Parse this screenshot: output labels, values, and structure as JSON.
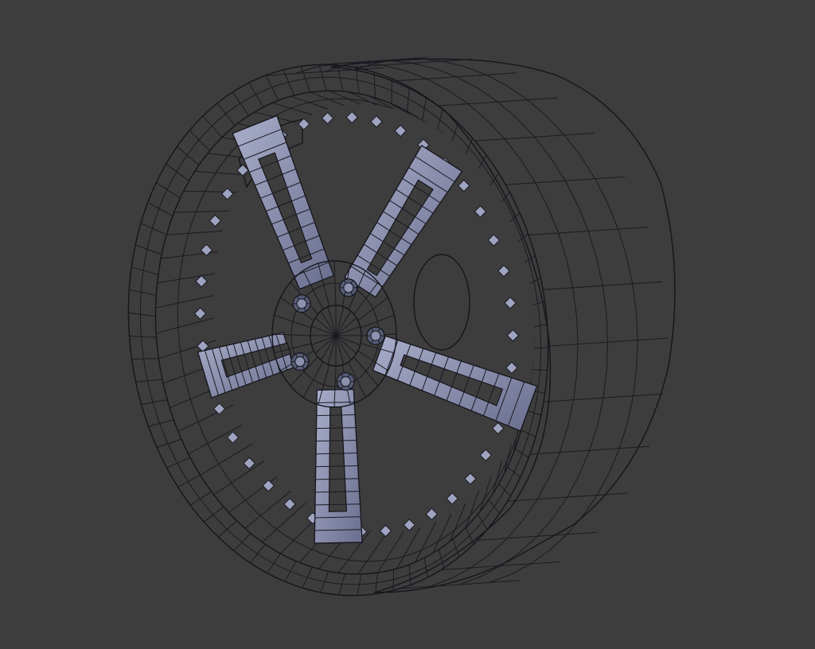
{
  "scene": {
    "subject": "wheel-rim-wireframe-model",
    "background_color": "#3d3d3d",
    "mesh_color": "#7a7f9c",
    "mesh_shadow_color": "#4a4d63",
    "mesh_highlight_color": "#b8bdd6",
    "wire_color": "#1a1a22",
    "lug_nut_count": 5,
    "spoke_count": 5,
    "rim_bolt_count": 40
  }
}
